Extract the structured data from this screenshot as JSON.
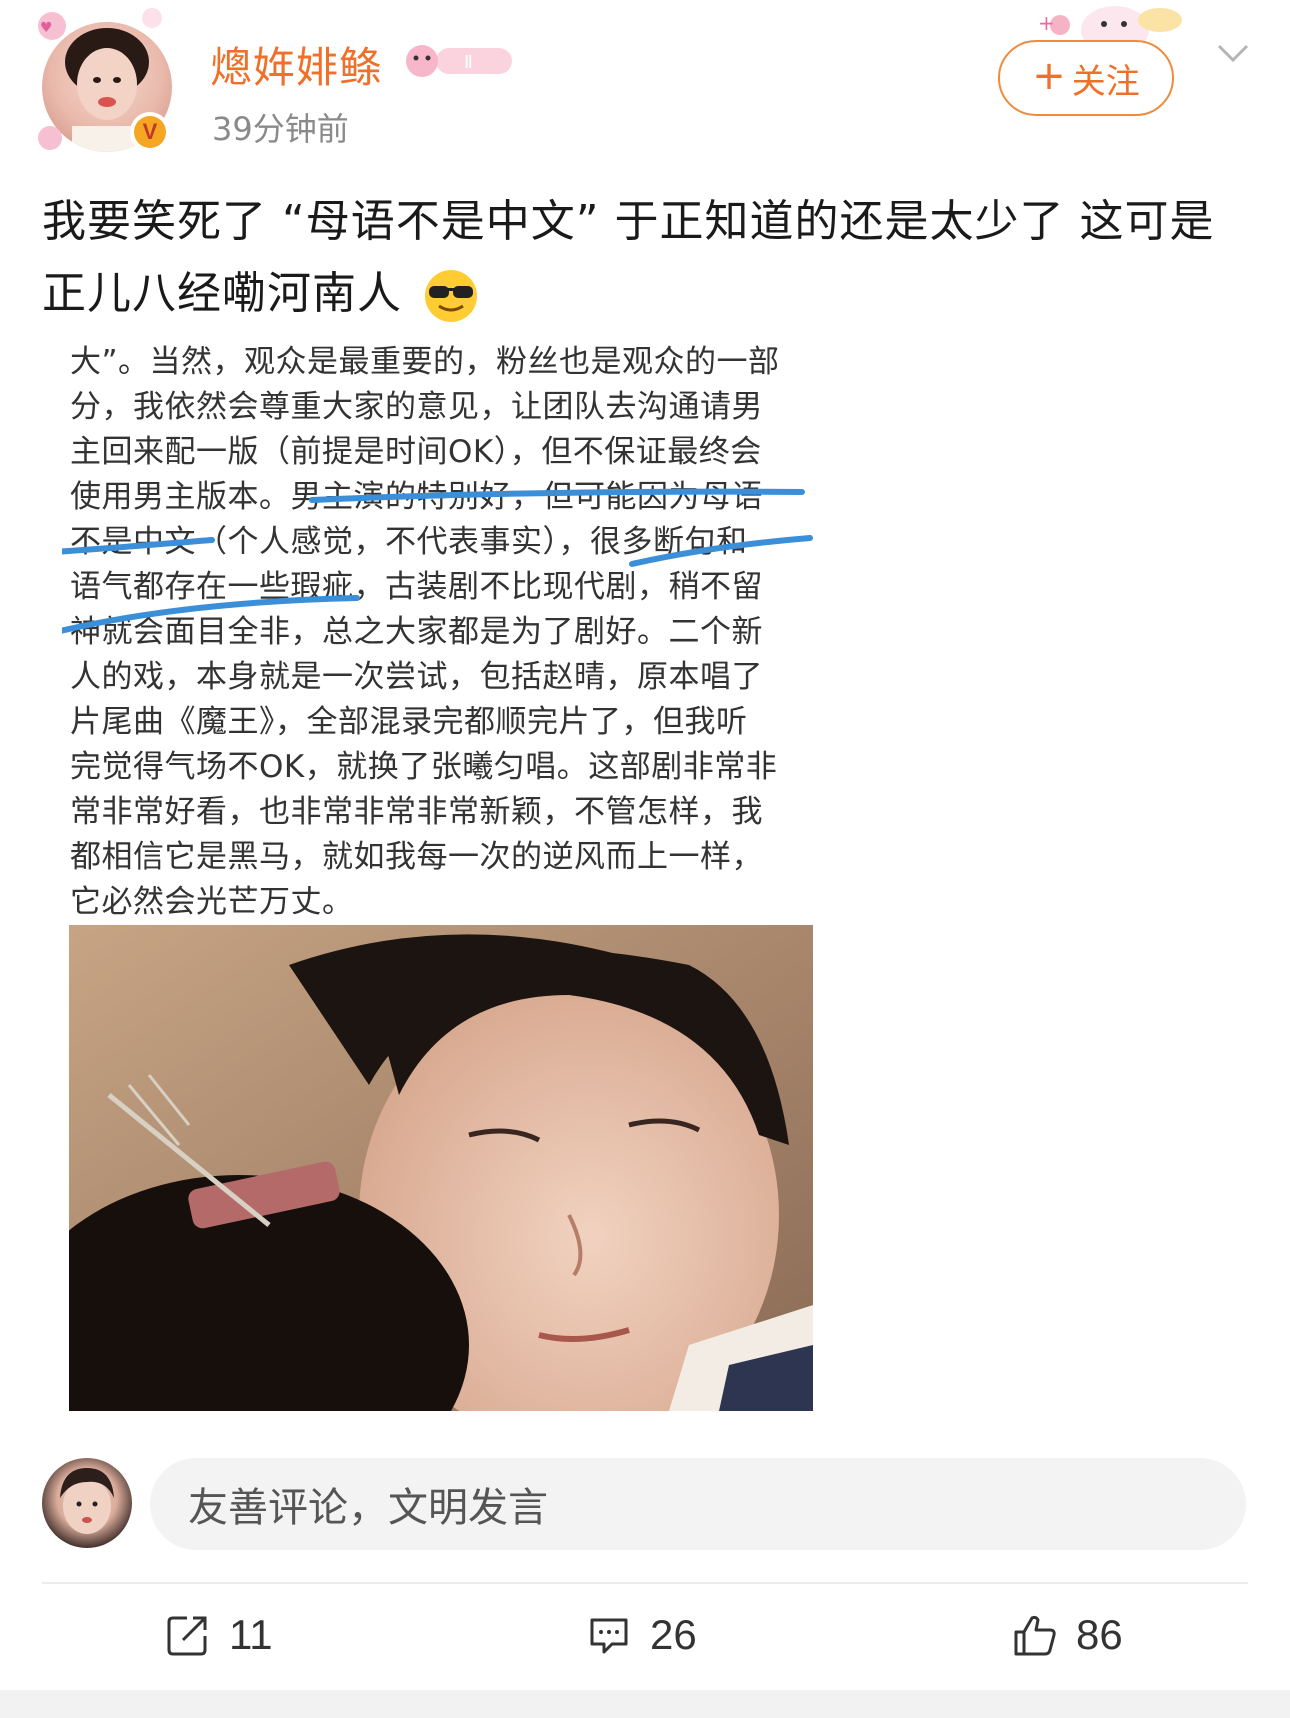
{
  "header": {
    "username": "熜姩婔�li",
    "username_display": "熜姩婔鲦",
    "level_badge": "Ⅱ",
    "verified_mark": "V",
    "timestamp": "39分钟前",
    "follow_label": "关注",
    "follow_icon": "plus-icon",
    "menu_icon": "chevron-down-icon"
  },
  "post": {
    "text": "我要笑死了 “母语不是中文” 于正知道的还是太少了 这可是正儿八经嘞河南人",
    "emoji": "sunglasses-emoji"
  },
  "quoted_screenshot": {
    "lines": [
      "大”。当然，观众是最重要的，粉丝也是观众的一部",
      "分，我依然会尊重大家的意见，让团队去沟通请男",
      "主回来配一版（前提是时间OK），但不保证最终会",
      "使用男主版本。男主演的特别好，但可能因为母语",
      "不是中文（个人感觉，不代表事实），很多断句和",
      "语气都存在一些瑕疵，古装剧不比现代剧，稍不留",
      "神就会面目全非，总之大家都是为了剧好。二个新",
      "人的戏，本身就是一次尝试，包括赵晴，原本唱了",
      "片尾曲《魔王》，全部混录完都顺完片了，但我听",
      "完觉得气场不OK，就换了张曦匀唱。这部剧非常非",
      "常非常好看，也非常非常非常新颖，不管怎样，我",
      "都相信它是黑马，就如我每一次的逆风而上一样，",
      "它必然会光芒万丈。"
    ],
    "underline_color": "#3a8fd8"
  },
  "comment": {
    "placeholder": "友善评论，文明发言"
  },
  "actions": {
    "repost_count": "11",
    "comment_count": "26",
    "like_count": "86"
  }
}
